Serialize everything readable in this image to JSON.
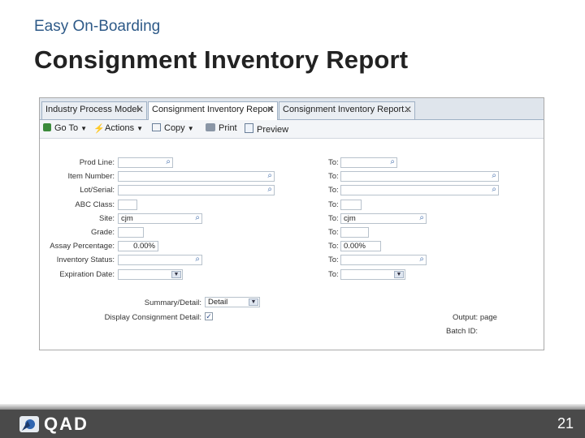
{
  "slide": {
    "subtitle": "Easy On-Boarding",
    "title": "Consignment Inventory Report",
    "page_number": "21",
    "logo_text": "QAD"
  },
  "tabs": [
    {
      "label": "Industry Process Model",
      "active": false
    },
    {
      "label": "Consignment Inventory Report",
      "active": true
    },
    {
      "label": "Consignment Inventory Report...",
      "active": false
    }
  ],
  "toolbar": {
    "goto": "Go To",
    "actions": "Actions",
    "copy": "Copy",
    "print": "Print",
    "preview": "Preview"
  },
  "form": {
    "prod_line": "Prod Line:",
    "item_number": "Item Number:",
    "lot_serial": "Lot/Serial:",
    "abc_class": "ABC Class:",
    "site": "Site:",
    "grade": "Grade:",
    "assay_percentage": "Assay Percentage:",
    "inventory_status": "Inventory Status:",
    "expiration_date": "Expiration Date:",
    "to": "To:",
    "site_from_value": "cjm",
    "site_to_value": "cjm",
    "assay_from_value": "0.00%",
    "assay_to_value": "0.00%",
    "summary_detail_label": "Summary/Detail:",
    "summary_detail_value": "Detail",
    "display_consignment_label": "Display Consignment Detail:",
    "display_consignment_checked": "✓",
    "output_label": "Output:",
    "output_value": "page",
    "batch_id_label": "Batch ID:"
  }
}
